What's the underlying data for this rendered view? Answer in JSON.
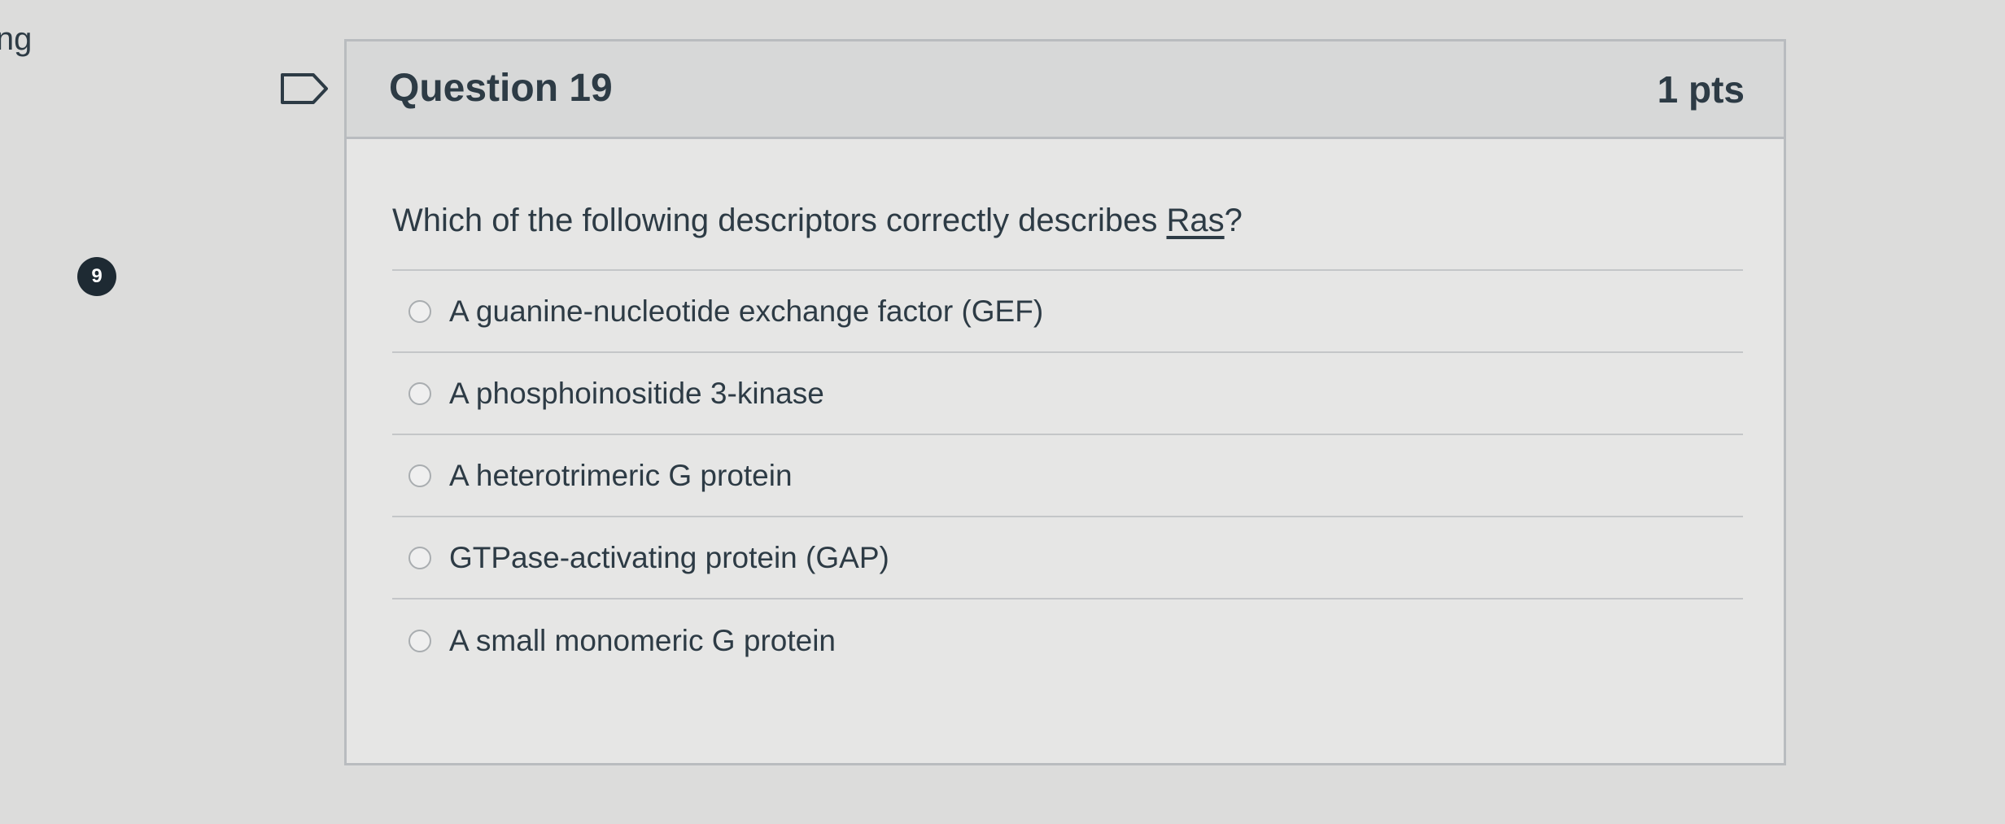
{
  "sidebar": {
    "stray_text": "ing",
    "question_number_badge": "9"
  },
  "question": {
    "title": "Question 19",
    "points": "1 pts",
    "text_before": "Which of the following descriptors correctly describes ",
    "text_term": "Ras",
    "text_after": "?",
    "answers": [
      {
        "label": "A guanine-nucleotide exchange factor (GEF)",
        "selected": false
      },
      {
        "label": "A phosphoinositide 3-kinase",
        "selected": false
      },
      {
        "label": "A heterotrimeric G protein",
        "selected": false
      },
      {
        "label": "GTPase-activating protein (GAP)",
        "selected": false
      },
      {
        "label": "A small monomeric G protein",
        "selected": false
      }
    ]
  }
}
